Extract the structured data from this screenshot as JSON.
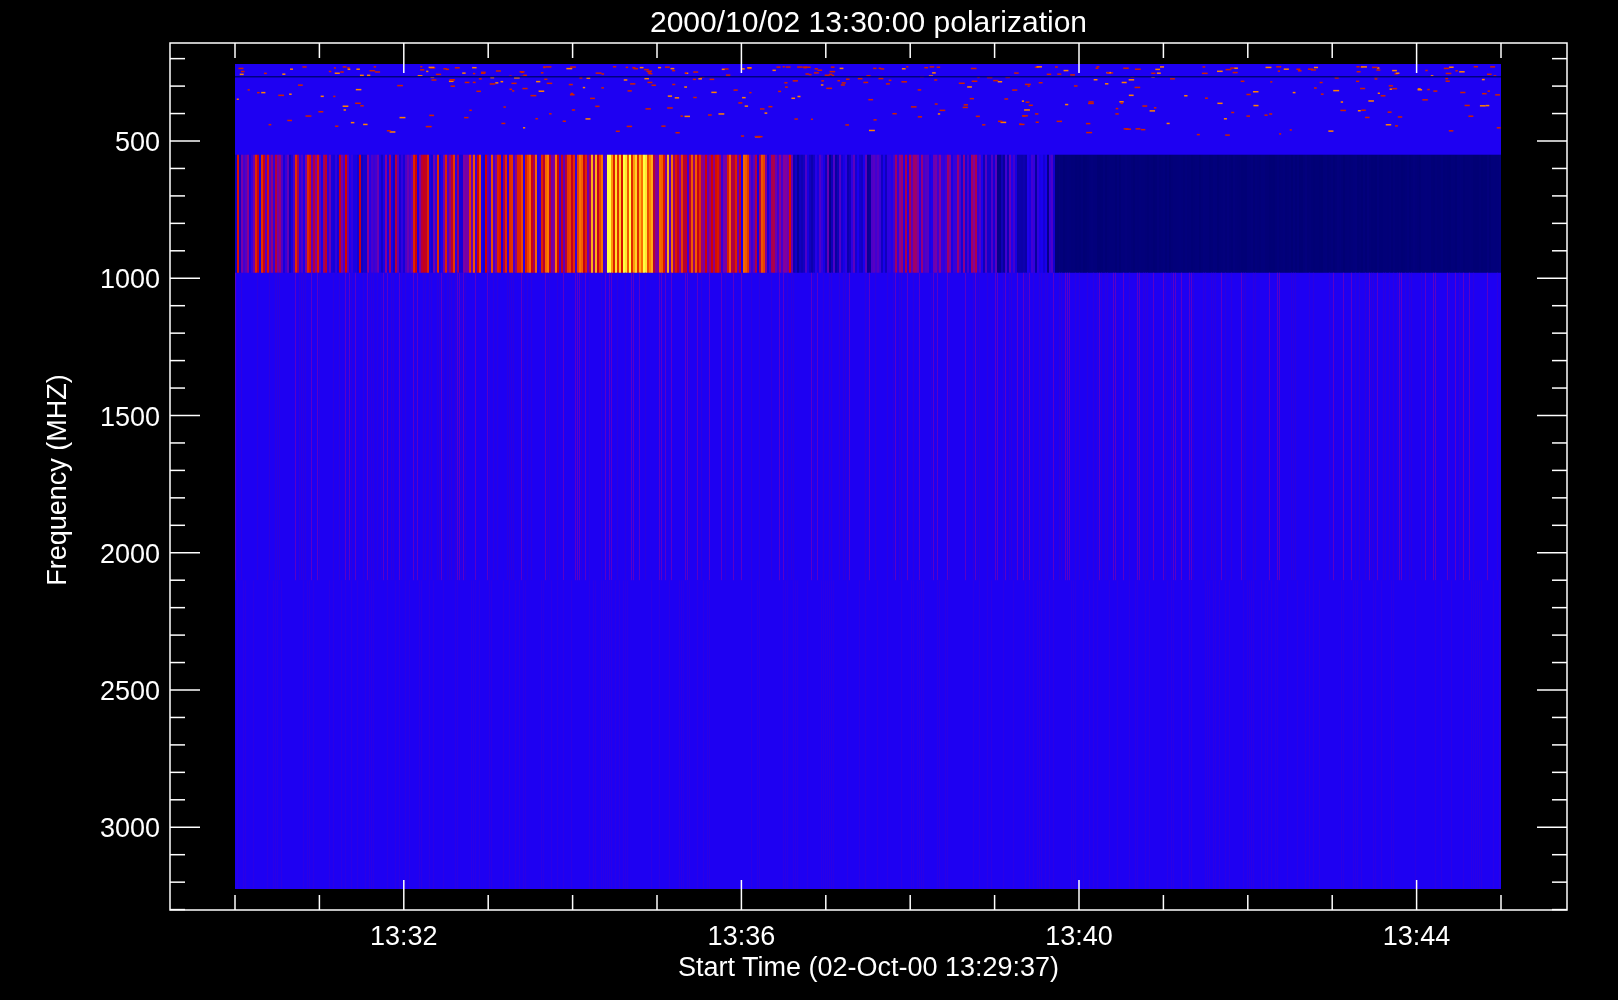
{
  "title": "2000/10/02 13:30:00 polarization",
  "y_axis": {
    "label": "Frequency (MHZ)",
    "ticks": [
      "500",
      "1000",
      "1500",
      "2000",
      "2500",
      "3000"
    ]
  },
  "x_axis": {
    "label": "Start Time (02-Oct-00 13:29:37)",
    "ticks": [
      "13:32",
      "13:36",
      "13:40",
      "13:44"
    ]
  }
}
